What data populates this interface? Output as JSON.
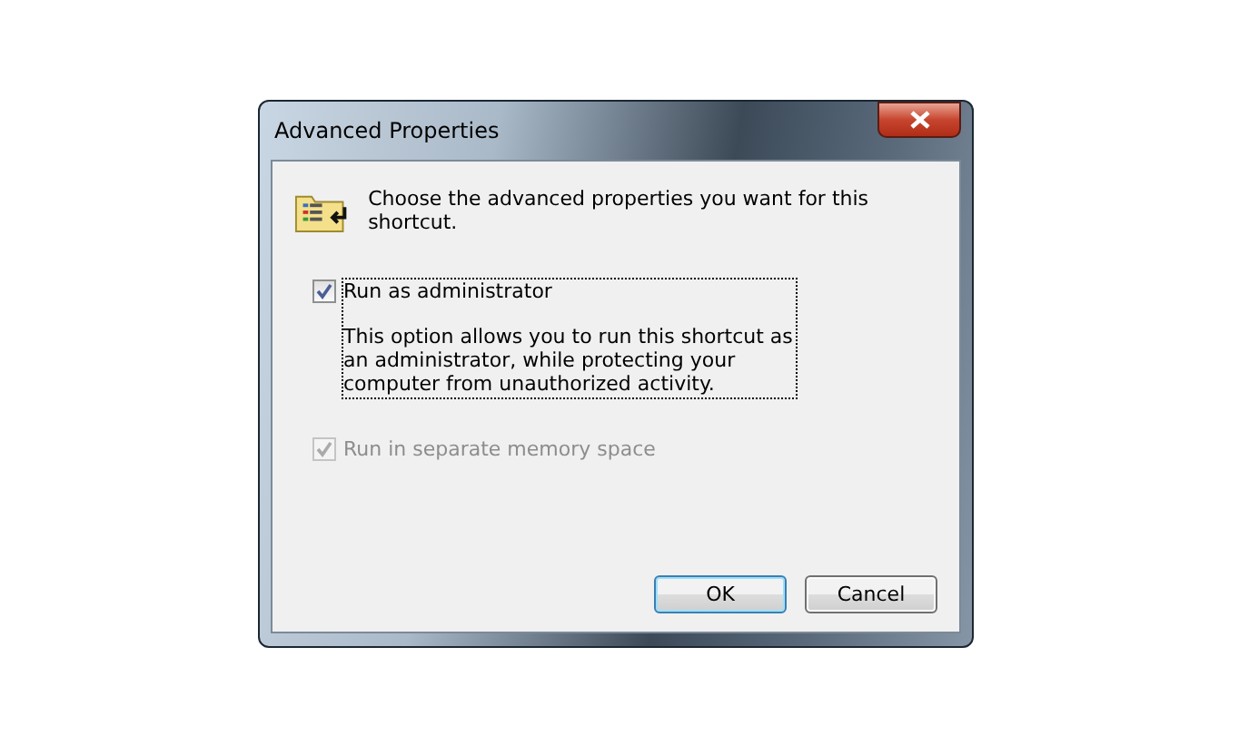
{
  "window": {
    "title": "Advanced Properties"
  },
  "header": {
    "text": "Choose the advanced properties you want for this shortcut."
  },
  "options": [
    {
      "label": "Run as administrator",
      "description": "This option allows you to run this shortcut as an administrator, while protecting your computer from unauthorized activity.",
      "checked": true,
      "disabled": false,
      "focused": true
    },
    {
      "label": "Run in separate memory space",
      "checked": true,
      "disabled": true,
      "focused": false
    }
  ],
  "buttons": [
    {
      "label": "OK",
      "kind": "default"
    },
    {
      "label": "Cancel",
      "kind": "normal"
    }
  ]
}
